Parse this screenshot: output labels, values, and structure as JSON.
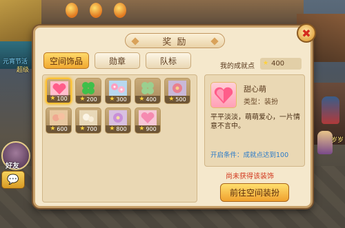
{
  "scene": {
    "left_text_1": "元宵节活",
    "left_text_2": "超级",
    "friend_label": "好友",
    "right_text": "岁岁"
  },
  "dialog": {
    "title": "奖 励",
    "close_glyph": "✖"
  },
  "tabs": [
    {
      "label": "空间饰品",
      "active": true
    },
    {
      "label": "勋章",
      "active": false
    },
    {
      "label": "队标",
      "active": false
    }
  ],
  "achievement": {
    "label": "我的成就点",
    "value": "400"
  },
  "items": [
    {
      "cost": "100",
      "icon": "pink-heart-icon",
      "selected": true
    },
    {
      "cost": "200",
      "icon": "green-clover-icon",
      "selected": false
    },
    {
      "cost": "300",
      "icon": "pink-flowers-icon",
      "selected": false
    },
    {
      "cost": "400",
      "icon": "faded-clover-icon",
      "selected": false
    },
    {
      "cost": "500",
      "icon": "red-flower-icon",
      "selected": false
    },
    {
      "cost": "600",
      "icon": "faded-blossom-icon",
      "selected": false
    },
    {
      "cost": "700",
      "icon": "faded-white-flower-icon",
      "selected": false
    },
    {
      "cost": "800",
      "icon": "faded-purple-flower-icon",
      "selected": false
    },
    {
      "cost": "900",
      "icon": "faded-pink-heart-icon",
      "selected": false
    }
  ],
  "detail": {
    "name": "甜心萌",
    "type": "类型：装扮",
    "description": "平平淡淡，萌萌爱心，一片情意不言中。",
    "condition": "开启条件：成就点达到100"
  },
  "status": "尚未获得该装饰",
  "action_button": "前往空间装扮"
}
